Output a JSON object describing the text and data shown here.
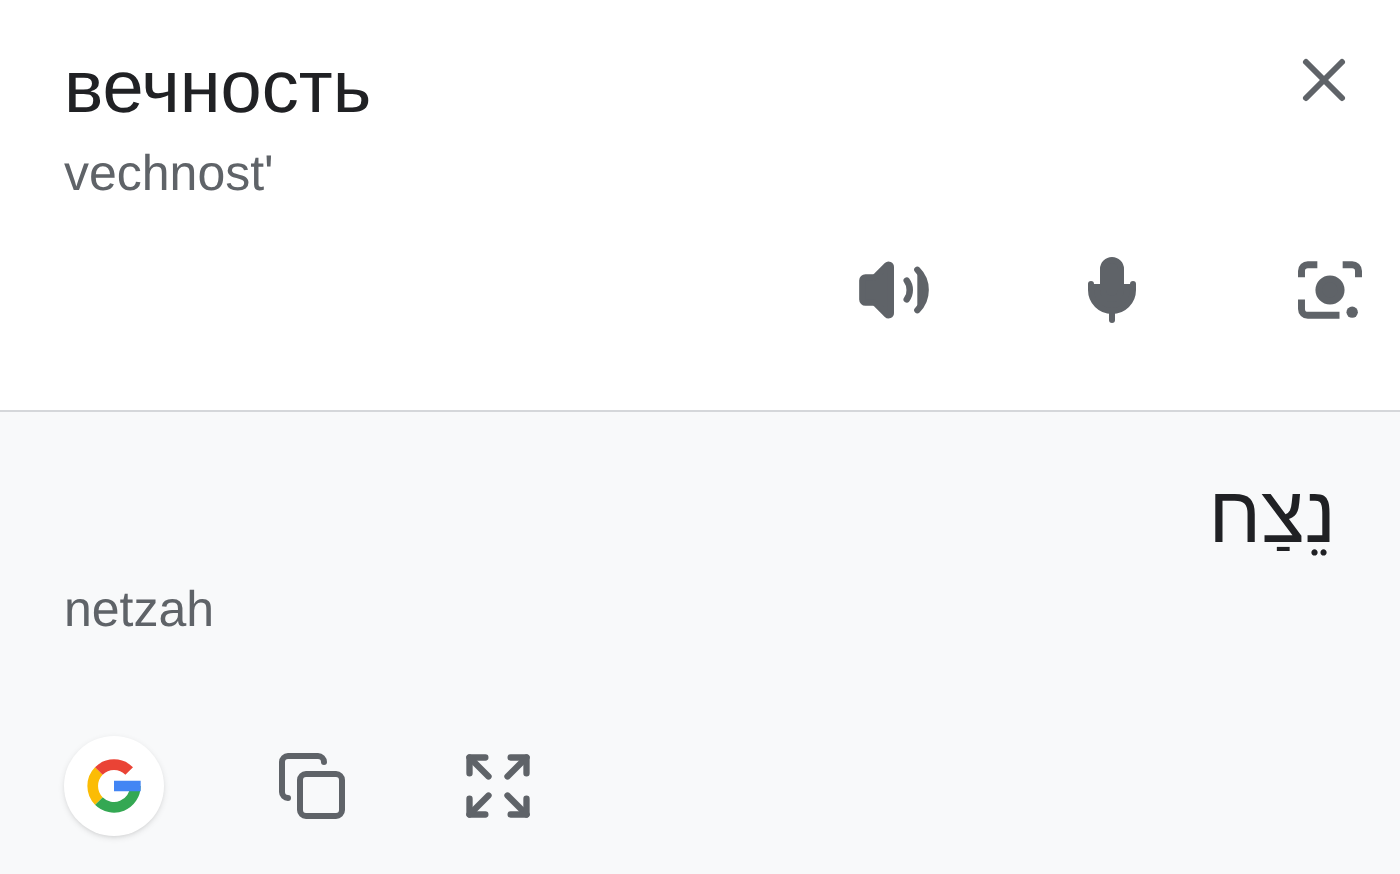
{
  "source": {
    "text": "вечность",
    "transliteration": "vechnost'"
  },
  "target": {
    "text": "נֵצַח",
    "transliteration": "netzah"
  }
}
